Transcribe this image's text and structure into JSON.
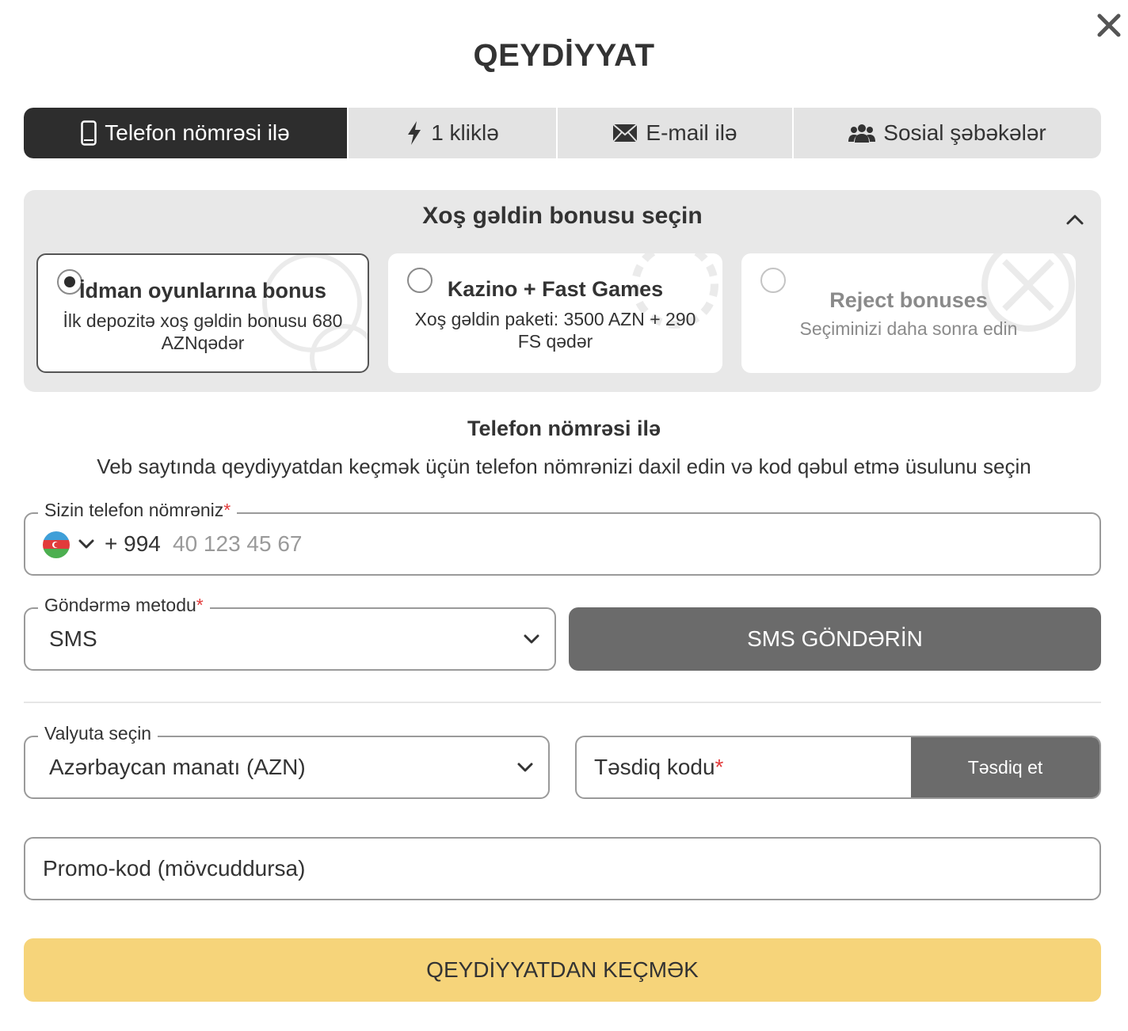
{
  "modal": {
    "title": "QEYDİYYAT",
    "close_icon": "close-icon"
  },
  "tabs": [
    {
      "label": "Telefon nömrəsi ilə",
      "icon": "mobile-phone-icon",
      "active": true
    },
    {
      "label": "1 kliklə",
      "icon": "lightning-icon",
      "active": false
    },
    {
      "label": "E-mail ilə",
      "icon": "envelope-icon",
      "active": false
    },
    {
      "label": "Sosial şəbəkələr",
      "icon": "users-icon",
      "active": false
    }
  ],
  "bonus": {
    "header": "Xoş gəldin bonusu seçin",
    "cards": [
      {
        "title": "İdman oyunlarına bonus",
        "subtitle": "İlk depozitə xoş gəldin bonusu 680 AZNqədər",
        "selected": true
      },
      {
        "title": "Kazino + Fast Games",
        "subtitle": "Xoş gəldin paketi: 3500 AZN + 290 FS qədər",
        "selected": false
      },
      {
        "title": "Reject bonuses",
        "subtitle": "Seçiminizi daha sonra edin",
        "selected": false
      }
    ]
  },
  "section": {
    "title": "Telefon nömrəsi ilə",
    "description": "Veb saytında qeydiyyatdan keçmək üçün telefon nömrənizi daxil edin və kod qəbul etmə üsulunu seçin"
  },
  "phone": {
    "label": "Sizin telefon nömrəniz",
    "required_mark": "*",
    "prefix": "+ 994",
    "placeholder": "40 123 45 67",
    "country_flag": "azerbaijan-flag-icon"
  },
  "method": {
    "label": "Göndərmə metodu",
    "required_mark": "*",
    "value": "SMS"
  },
  "sms_button": "SMS GÖNDƏRİN",
  "currency": {
    "label": "Valyuta seçin",
    "value": "Azərbaycan manatı (AZN)"
  },
  "code": {
    "label": "Təsdiq kodu",
    "required_mark": "*",
    "confirm_button": "Təsdiq et"
  },
  "promo": {
    "placeholder": "Promo-kod (mövcuddursa)"
  },
  "register_button": "QEYDİYYATDAN KEÇMƏK",
  "colors": {
    "active_tab": "#2d2d2d",
    "secondary_button": "#6b6b6b",
    "primary_button": "#f6d47a",
    "required": "#e23b3b"
  }
}
